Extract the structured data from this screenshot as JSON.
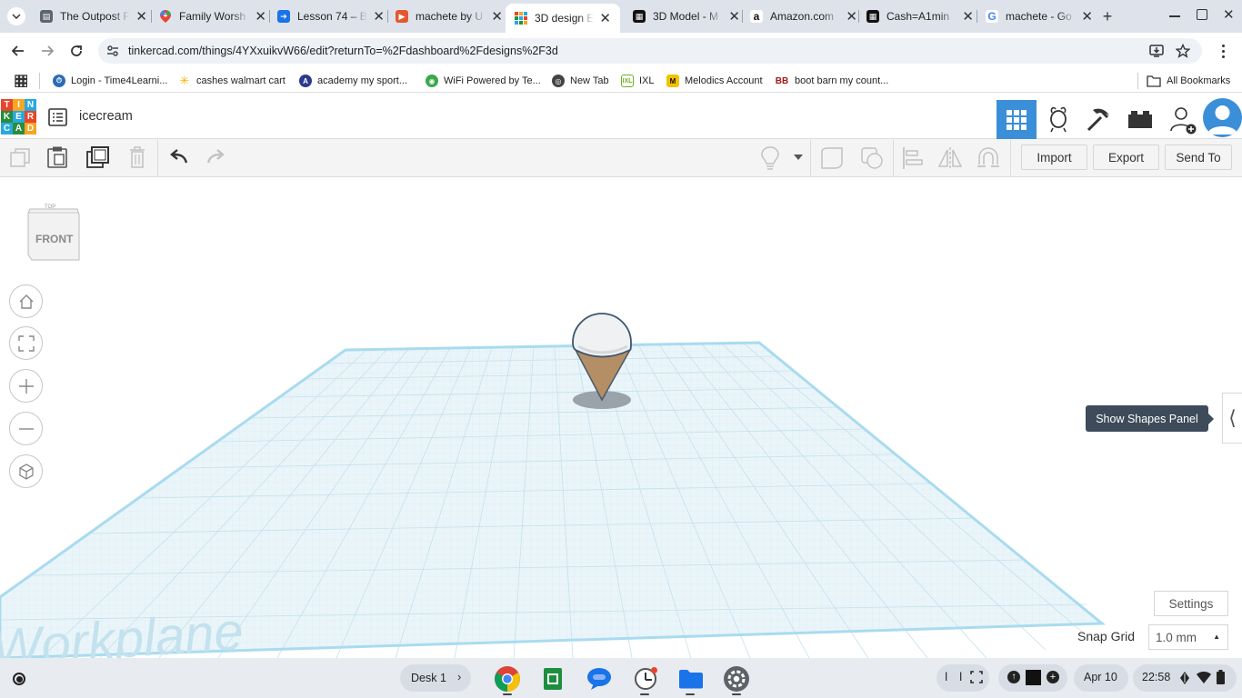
{
  "browser": {
    "tabs": [
      {
        "title": "The Outpost F",
        "favicon": "document-icon",
        "active": false
      },
      {
        "title": "Family Worsh",
        "favicon": "maps-pin-icon",
        "active": false
      },
      {
        "title": "Lesson 74 – B",
        "favicon": "runner-icon",
        "active": false
      },
      {
        "title": "machete by U",
        "favicon": "play-icon",
        "active": false
      },
      {
        "title": "3D design Ep",
        "favicon": "tinkercad-icon",
        "active": true
      },
      {
        "title": "3D Model - M",
        "favicon": "checker-icon",
        "active": false
      },
      {
        "title": "Amazon.com",
        "favicon": "amazon-icon",
        "active": false
      },
      {
        "title": "Cash=A1min",
        "favicon": "checker-icon",
        "active": false
      },
      {
        "title": "machete - Go",
        "favicon": "google-icon",
        "active": false
      }
    ],
    "url": "tinkercad.com/things/4YXxuikvW66/edit?returnTo=%2Fdashboard%2Fdesigns%2F3d",
    "bookmarks": [
      {
        "label": "Login - Time4Learni...",
        "color": "#2a6db5"
      },
      {
        "label": "cashes walmart cart",
        "color": "#f5b400"
      },
      {
        "label": "academy my sport...",
        "color": "#2b3a8f"
      },
      {
        "label": "WiFi Powered by Te...",
        "color": "#3aa84a"
      },
      {
        "label": "New Tab",
        "color": "#444444"
      },
      {
        "label": "IXL",
        "color": "#6ab023"
      },
      {
        "label": "Melodics Account",
        "color": "#f2c200"
      },
      {
        "label": "boot barn my count...",
        "color": "#a01818"
      }
    ],
    "all_bookmarks": "All Bookmarks"
  },
  "tinkercad": {
    "logo_letters": [
      "T",
      "I",
      "N",
      "K",
      "E",
      "R",
      "C",
      "A",
      "D"
    ],
    "design_name": "icecream",
    "toolbar": {
      "import": "Import",
      "export": "Export",
      "send_to": "Send To"
    },
    "view_cube": {
      "front": "FRONT",
      "top": "TOP"
    },
    "workplane_label": "Workplane",
    "tooltip": "Show Shapes Panel",
    "settings": "Settings",
    "snap_grid_label": "Snap Grid",
    "snap_grid_value": "1.0 mm"
  },
  "shelf": {
    "desk": "Desk 1",
    "date": "Apr 10",
    "time": "22:58"
  }
}
